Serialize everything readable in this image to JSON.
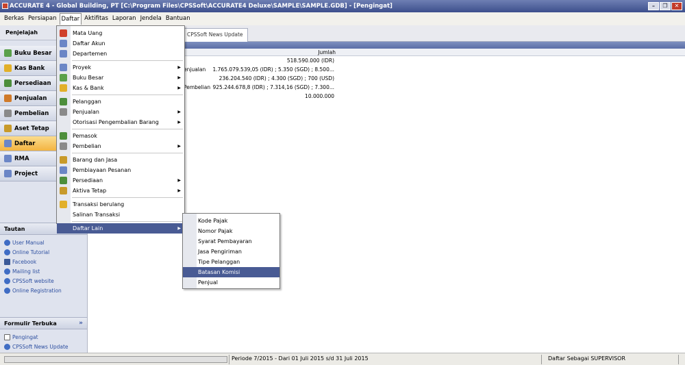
{
  "window": {
    "title": "ACCURATE 4  - Global Building, PT  [C:\\Program Files\\CPSSoft\\ACCURATE4 Deluxe\\SAMPLE\\SAMPLE.GDB] - [Pengingat]"
  },
  "menubar": [
    "Berkas",
    "Persiapan",
    "Daftar",
    "Aktifitas",
    "Laporan",
    "Jendela",
    "Bantuan"
  ],
  "nav": {
    "header": "Penjelajah",
    "buttons": [
      {
        "label": "Buku Besar",
        "icon": "ledger-icon",
        "color": "#5aa04a"
      },
      {
        "label": "Kas Bank",
        "icon": "cash-bank-icon",
        "color": "#e2b02a"
      },
      {
        "label": "Persediaan",
        "icon": "inventory-icon",
        "color": "#4d8e3c"
      },
      {
        "label": "Penjualan",
        "icon": "sales-icon",
        "color": "#d07a2a"
      },
      {
        "label": "Pembelian",
        "icon": "purchase-icon",
        "color": "#8a8a8a"
      },
      {
        "label": "Aset Tetap",
        "icon": "fixed-asset-icon",
        "color": "#c89a2a"
      },
      {
        "label": "Daftar",
        "icon": "list-icon",
        "color": "#6b86c6"
      },
      {
        "label": "RMA",
        "icon": "rma-icon",
        "color": "#6b86c6"
      },
      {
        "label": "Project",
        "icon": "project-icon",
        "color": "#6b86c6"
      }
    ],
    "tautan": {
      "header": "Tautan",
      "links": [
        {
          "label": "User Manual",
          "icon": "help-icon"
        },
        {
          "label": "Online Tutorial",
          "icon": "help-icon"
        },
        {
          "label": "Facebook",
          "icon": "facebook-icon"
        },
        {
          "label": "Mailing list",
          "icon": "people-icon"
        },
        {
          "label": "CPSSoft website",
          "icon": "web-icon"
        },
        {
          "label": "Online Registration",
          "icon": "web-icon"
        }
      ]
    },
    "formulir": {
      "header": "Formulir Terbuka",
      "chevron": "»",
      "items": [
        {
          "label": "Pengingat",
          "icon": "document-icon"
        },
        {
          "label": "CPSSoft News Update",
          "icon": "web-icon"
        }
      ]
    }
  },
  "main": {
    "tab": "CPSSoft News Update",
    "column_header": "Jumlah",
    "rows": [
      {
        "label": "",
        "amount": "518.590.000 (IDR)"
      },
      {
        "label": "enjualan",
        "amount": "1.765.079.539,05 (IDR) ; 5.350 (SGD) ; 8.500..."
      },
      {
        "label": "",
        "amount": "236.204.540 (IDR) ; 4.300 (SGD) ; 700 (USD)"
      },
      {
        "label": "Pembelian",
        "amount": "925.244.678,8 (IDR) ; 7.314,16 (SGD) ; 7.300..."
      },
      {
        "label": "",
        "amount": "10.000.000"
      }
    ]
  },
  "dropdown": {
    "items": [
      {
        "label": "Mata Uang",
        "icon": "currency-icon",
        "color": "#d0402a",
        "arrow": false
      },
      {
        "label": "Daftar Akun",
        "icon": "account-list-icon",
        "color": "#6b86c6",
        "arrow": false
      },
      {
        "label": "Departemen",
        "icon": "department-icon",
        "color": "#6b86c6",
        "arrow": false
      },
      {
        "label": "Proyek",
        "icon": "project-icon",
        "color": "#6b86c6",
        "arrow": true
      },
      {
        "label": "Buku Besar",
        "icon": "ledger-icon",
        "color": "#5aa04a",
        "arrow": true
      },
      {
        "label": "Kas & Bank",
        "icon": "cash-bank-icon",
        "color": "#e2b02a",
        "arrow": true
      },
      {
        "label": "Pelanggan",
        "icon": "customer-icon",
        "color": "#4d8e3c",
        "arrow": false
      },
      {
        "label": "Penjualan",
        "icon": "sales-icon",
        "color": "#8a8a8a",
        "arrow": true
      },
      {
        "label": "Otorisasi Pengembalian Barang",
        "icon": "",
        "color": "",
        "arrow": true
      },
      {
        "label": "Pemasok",
        "icon": "supplier-icon",
        "color": "#4d8e3c",
        "arrow": false
      },
      {
        "label": "Pembelian",
        "icon": "purchase-icon",
        "color": "#8a8a8a",
        "arrow": true
      },
      {
        "label": "Barang dan Jasa",
        "icon": "goods-icon",
        "color": "#c89a2a",
        "arrow": false
      },
      {
        "label": "Pembiayaan Pesanan",
        "icon": "order-icon",
        "color": "#6b86c6",
        "arrow": false
      },
      {
        "label": "Persediaan",
        "icon": "inventory-icon",
        "color": "#4d8e3c",
        "arrow": true
      },
      {
        "label": "Aktiva Tetap",
        "icon": "fixed-asset-icon",
        "color": "#c89a2a",
        "arrow": true
      },
      {
        "label": "Transaksi berulang",
        "icon": "recurring-icon",
        "color": "#e2b02a",
        "arrow": false
      },
      {
        "label": "Salinan Transaksi",
        "icon": "",
        "color": "",
        "arrow": false
      },
      {
        "label": "Daftar Lain",
        "icon": "",
        "color": "",
        "arrow": true
      }
    ]
  },
  "submenu": {
    "items": [
      "Kode Pajak",
      "Nomor Pajak",
      "Syarat Pembayaran",
      "Jasa Pengiriman",
      "Tipe Pelanggan",
      "Batasan Komisi",
      "Penjual"
    ]
  },
  "statusbar": {
    "period": "Periode 7/2015 - Dari 01 Juli 2015 s/d 31 Juli 2015",
    "user": "Daftar Sebagai SUPERVISOR"
  }
}
